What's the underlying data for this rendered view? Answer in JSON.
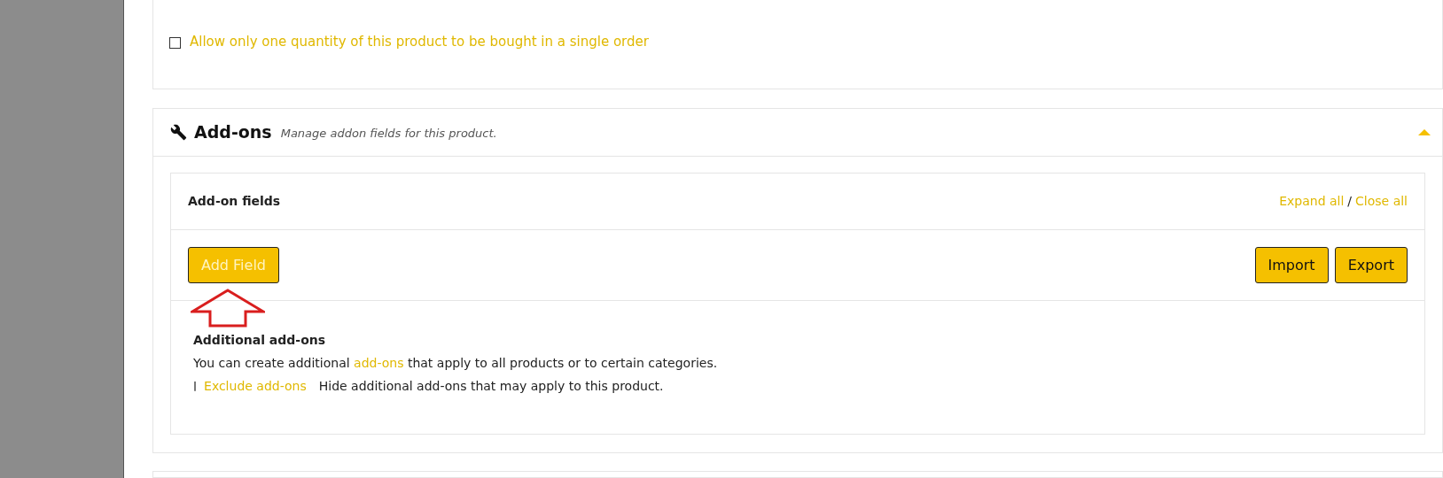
{
  "options": [
    {
      "label": "Allow only one quantity of this product to be bought in a single order",
      "checked": false
    }
  ],
  "addons": {
    "title": "Add-ons",
    "description": "Manage addon fields for this product.",
    "expanded": true,
    "panel": {
      "title": "Add-on fields",
      "expand_all": "Expand all",
      "separator": "/",
      "close_all": "Close all",
      "buttons": [
        {
          "label": "Add Field",
          "kind": "add"
        },
        {
          "label": "Import",
          "kind": "tool"
        },
        {
          "label": "Export",
          "kind": "tool"
        }
      ],
      "additional": {
        "heading": "Additional add-ons",
        "text_before": "You can create additional",
        "link": "add-ons",
        "text_after": "that apply to all products or to certain categories.",
        "toggle_mark": "|",
        "exclude_link": "Exclude add-ons",
        "exclude_text": "Hide additional add-ons that may apply to this product."
      }
    }
  }
}
